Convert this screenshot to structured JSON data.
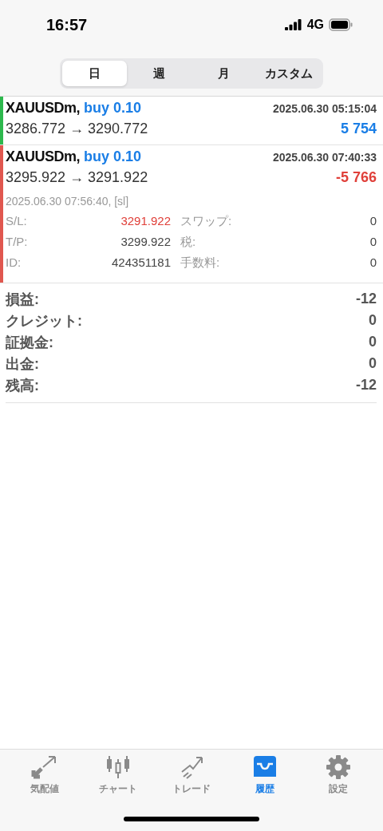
{
  "status_bar": {
    "time": "16:57",
    "network": "4G"
  },
  "period_tabs": [
    {
      "label": "日",
      "selected": true
    },
    {
      "label": "週",
      "selected": false
    },
    {
      "label": "月",
      "selected": false
    },
    {
      "label": "カスタム",
      "selected": false
    }
  ],
  "deals": [
    {
      "symbol": "XAUUSDm,",
      "side": "buy 0.10",
      "time": "2025.06.30 05:15:04",
      "prices": "3286.772 → 3290.772",
      "profit": "5 754",
      "kind": "profit",
      "color": "#2db84d"
    },
    {
      "symbol": "XAUUSDm,",
      "side": "buy 0.10",
      "time": "2025.06.30 07:40:33",
      "prices": "3295.922 → 3291.922",
      "profit": "-5 766",
      "kind": "loss",
      "color": "#e0574f",
      "close_info": "2025.06.30 07:56:40, [sl]",
      "details": [
        {
          "label": "S/L:",
          "value": "3291.922",
          "highlight": true,
          "label2": "スワップ:",
          "value2": "0"
        },
        {
          "label": "T/P:",
          "value": "3299.922",
          "highlight": false,
          "label2": "税:",
          "value2": "0"
        },
        {
          "label": "ID:",
          "value": "424351181",
          "highlight": false,
          "label2": "手数料:",
          "value2": "0"
        }
      ]
    }
  ],
  "summary": [
    {
      "label": "損益:",
      "value": "-12"
    },
    {
      "label": "クレジット:",
      "value": "0"
    },
    {
      "label": "証拠金:",
      "value": "0"
    },
    {
      "label": "出金:",
      "value": "0"
    },
    {
      "label": "残高:",
      "value": "-12"
    }
  ],
  "bottom_tabs": [
    {
      "label": "気配値",
      "selected": false
    },
    {
      "label": "チャート",
      "selected": false
    },
    {
      "label": "トレード",
      "selected": false
    },
    {
      "label": "履歴",
      "selected": true
    },
    {
      "label": "設定",
      "selected": false
    }
  ]
}
